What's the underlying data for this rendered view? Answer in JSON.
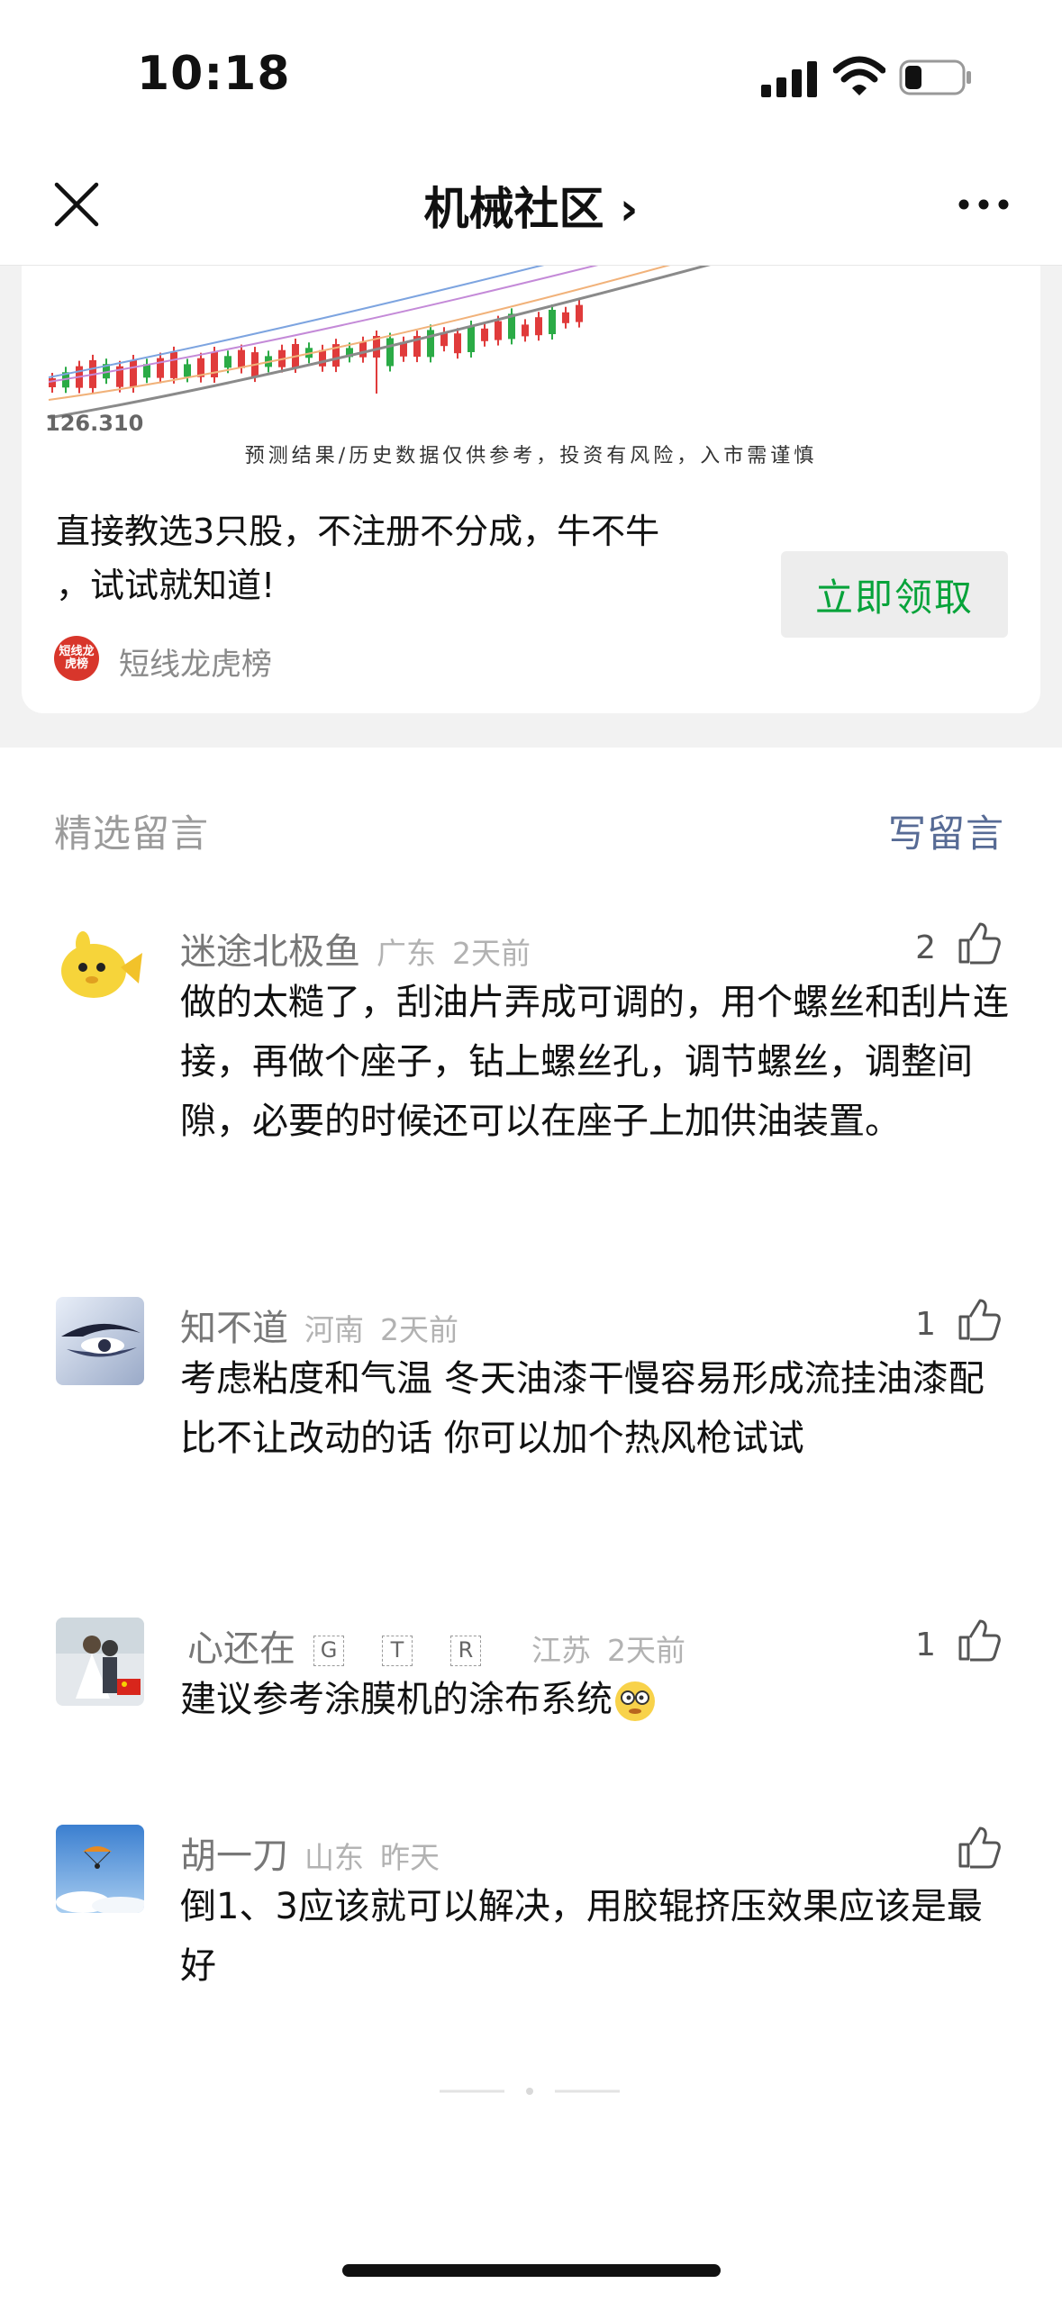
{
  "status": {
    "time": "10:18"
  },
  "nav": {
    "title": "机械社区 ›"
  },
  "ad": {
    "chart_tick": "126.310",
    "disclaimer": "预测结果/历史数据仅供参考，投资有风险，入市需谨慎",
    "text_line1": "直接教选3只股，不注册不分成，牛不牛",
    "text_line2": "，试试就知道!",
    "button_label": "立即领取",
    "brand_logo_text": "短线龙虎榜",
    "brand_name": "短线龙虎榜"
  },
  "comments_header": {
    "title": "精选留言",
    "write_label": "写留言"
  },
  "comments": [
    {
      "name": "迷途北极鱼",
      "region": "广东",
      "time": "2天前",
      "likes": "2",
      "text": "做的太糙了，刮油片弄成可调的，用个螺丝和刮片连接，再做个座子，钻上螺丝孔，调节螺丝，调整间隙，必要的时候还可以在座子上加供油装置。"
    },
    {
      "name": "知不道",
      "region": "河南",
      "time": "2天前",
      "likes": "1",
      "text": "考虑粘度和气温 冬天油漆干慢容易形成流挂油漆配比不让改动的话 你可以加个热风枪试试"
    },
    {
      "name": "心还在",
      "tags": [
        "G",
        "T",
        "R"
      ],
      "region": "江苏",
      "time": "2天前",
      "likes": "1",
      "text": "建议参考涂膜机的涂布系统"
    },
    {
      "name": "胡一刀",
      "region": "山东",
      "time": "昨天",
      "likes": "",
      "text": "倒1、3应该就可以解决，用胶辊挤压效果应该是最好"
    }
  ],
  "icons": {
    "signal": "signal-icon",
    "wifi": "wifi-icon",
    "battery": "battery-icon",
    "close": "close-icon",
    "more": "more-icon",
    "like": "thumbs-up-icon",
    "emoji": "dizzy-face-emoji"
  },
  "colors": {
    "accent_green": "#07a33a",
    "link_blue": "#576b95",
    "meta_gray": "#b2b2b2"
  }
}
